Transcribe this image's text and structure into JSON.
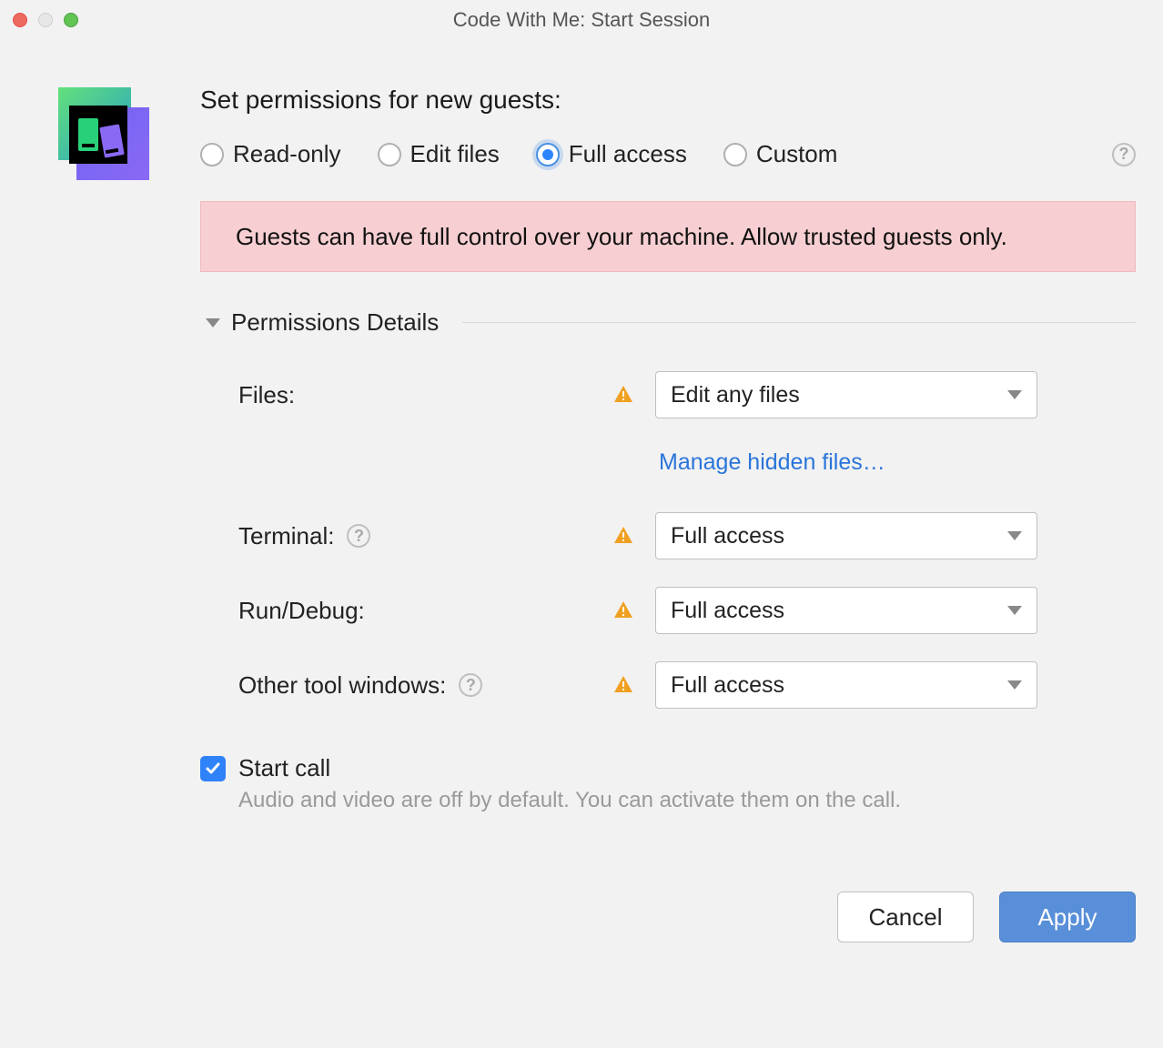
{
  "window": {
    "title": "Code With Me: Start Session"
  },
  "heading": "Set permissions for new guests:",
  "radios": {
    "readonly": "Read-only",
    "edit": "Edit files",
    "full": "Full access",
    "custom": "Custom",
    "selected": "full"
  },
  "banner": "Guests can have full control over your machine. Allow trusted guests only.",
  "details": {
    "title": "Permissions Details",
    "files_label": "Files:",
    "files_value": "Edit any files",
    "manage_hidden": "Manage hidden files…",
    "terminal_label": "Terminal:",
    "terminal_value": "Full access",
    "rundebug_label": "Run/Debug:",
    "rundebug_value": "Full access",
    "other_label": "Other tool windows:",
    "other_value": "Full access"
  },
  "startcall": {
    "label": "Start call",
    "sub": "Audio and video are off by default. You can activate them on the call."
  },
  "buttons": {
    "cancel": "Cancel",
    "apply": "Apply"
  }
}
